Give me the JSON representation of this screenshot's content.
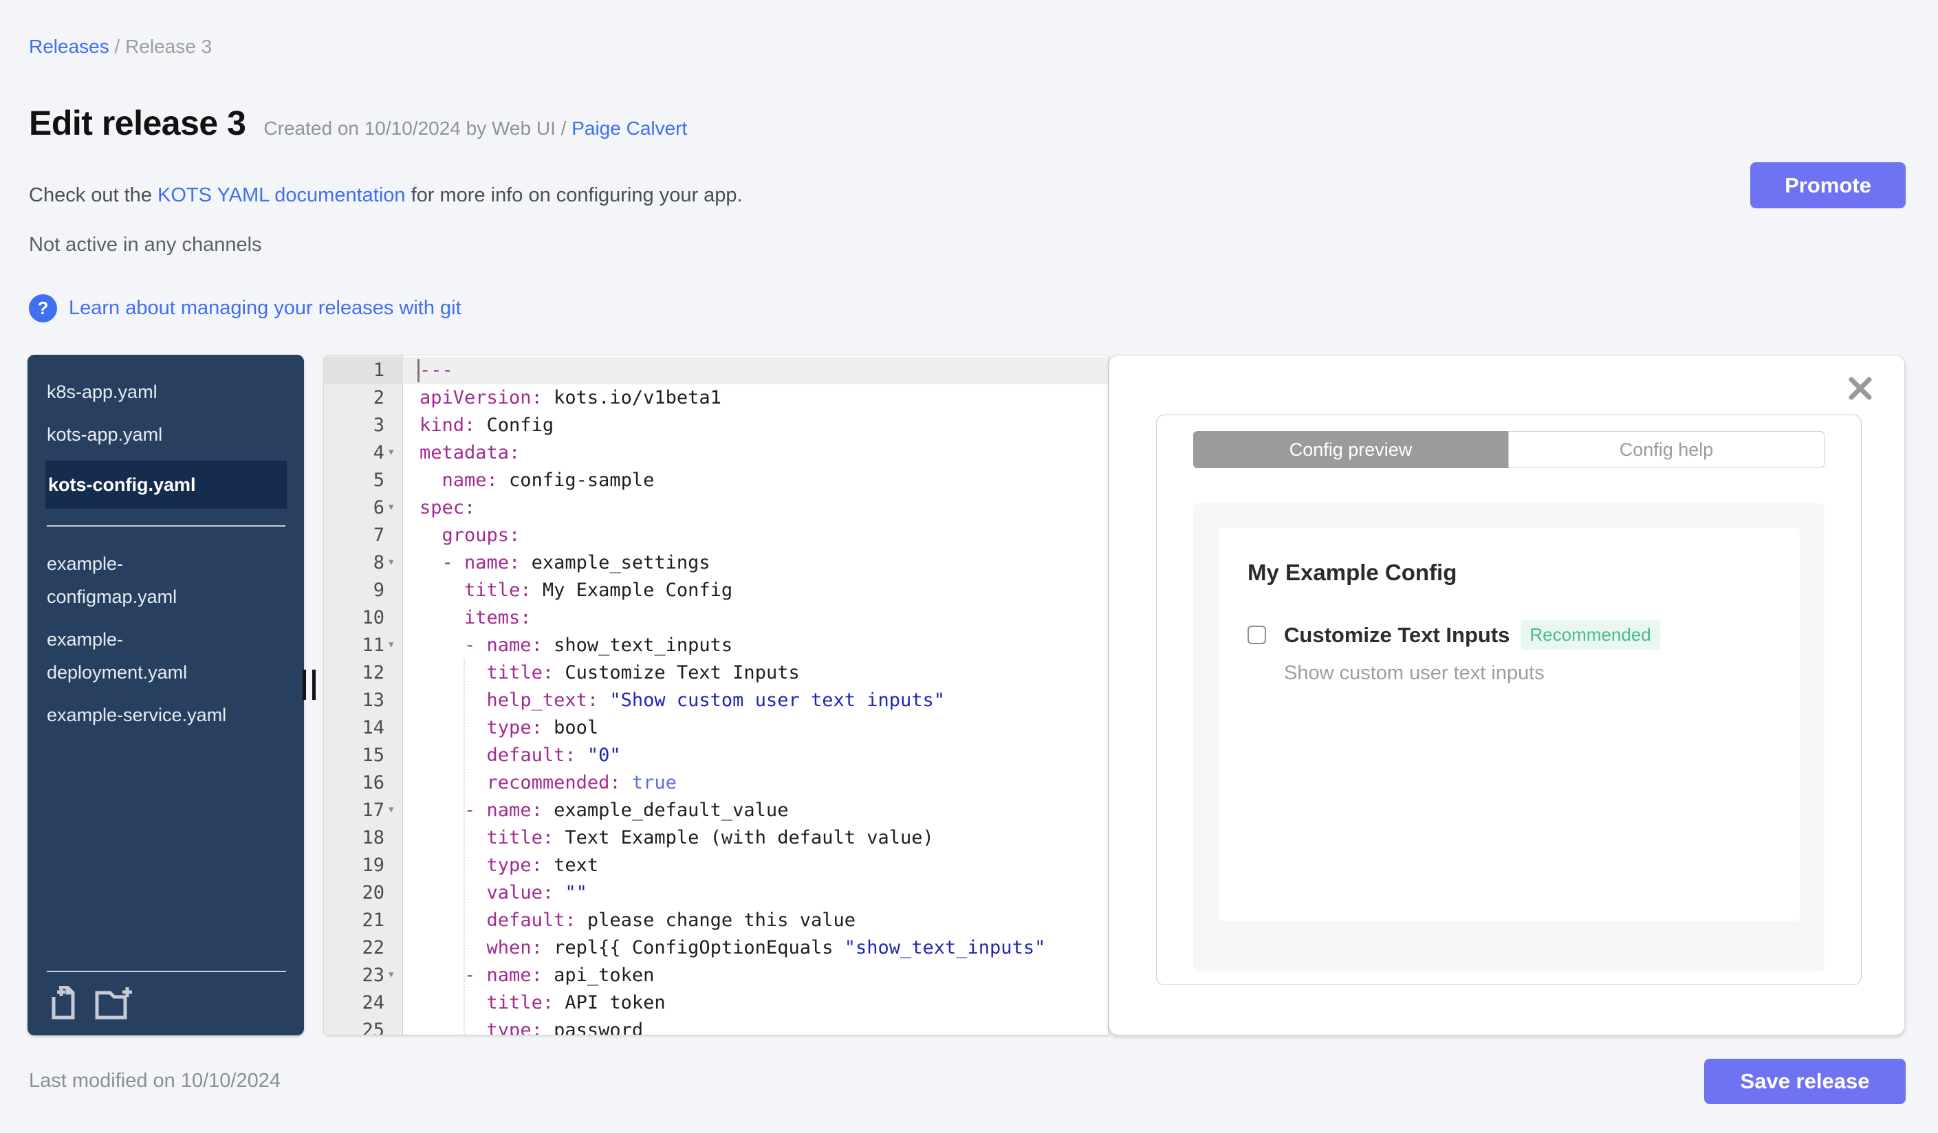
{
  "breadcrumb": {
    "link": "Releases",
    "separator": "/",
    "current": "Release 3"
  },
  "header": {
    "title": "Edit release 3",
    "created_prefix": "Created on 10/10/2024 by Web UI /",
    "created_link": "Paige Calvert",
    "promote_label": "Promote"
  },
  "intro": {
    "pre": "Check out the ",
    "link": "KOTS YAML documentation",
    "post": " for more info on configuring your app.",
    "channel_status": "Not active in any channels"
  },
  "git_link": {
    "icon": "?",
    "label": "Learn about managing your releases with git"
  },
  "sidebar": {
    "files_top": [
      {
        "label": "k8s-app.yaml",
        "selected": false
      },
      {
        "label": "kots-app.yaml",
        "selected": false
      },
      {
        "label": "kots-config.yaml",
        "selected": true
      }
    ],
    "files_bottom": [
      {
        "label": "example-configmap.yaml",
        "selected": false
      },
      {
        "label": "example-deployment.yaml",
        "selected": false
      },
      {
        "label": "example-service.yaml",
        "selected": false
      }
    ],
    "icons": [
      "new-file-icon",
      "new-folder-icon"
    ]
  },
  "editor": {
    "lines": [
      {
        "n": 1,
        "fold": false,
        "active": true,
        "seg": [
          [
            "k",
            "---"
          ]
        ]
      },
      {
        "n": 2,
        "fold": false,
        "active": false,
        "seg": [
          [
            "k",
            "apiVersion:"
          ],
          [
            "v",
            " kots.io/v1beta1"
          ]
        ]
      },
      {
        "n": 3,
        "fold": false,
        "active": false,
        "seg": [
          [
            "k",
            "kind:"
          ],
          [
            "v",
            " Config"
          ]
        ]
      },
      {
        "n": 4,
        "fold": true,
        "active": false,
        "seg": [
          [
            "k",
            "metadata:"
          ]
        ]
      },
      {
        "n": 5,
        "fold": false,
        "active": false,
        "seg": [
          [
            "v",
            "  "
          ],
          [
            "k",
            "name:"
          ],
          [
            "v",
            " config-sample"
          ]
        ]
      },
      {
        "n": 6,
        "fold": true,
        "active": false,
        "seg": [
          [
            "k",
            "spec:"
          ]
        ]
      },
      {
        "n": 7,
        "fold": false,
        "active": false,
        "seg": [
          [
            "v",
            "  "
          ],
          [
            "k",
            "groups:"
          ]
        ]
      },
      {
        "n": 8,
        "fold": true,
        "active": false,
        "seg": [
          [
            "v",
            "  "
          ],
          [
            "k",
            "- name:"
          ],
          [
            "v",
            " example_settings"
          ]
        ]
      },
      {
        "n": 9,
        "fold": false,
        "active": false,
        "seg": [
          [
            "v",
            "    "
          ],
          [
            "k",
            "title:"
          ],
          [
            "v",
            " My Example Config"
          ]
        ]
      },
      {
        "n": 10,
        "fold": false,
        "active": false,
        "seg": [
          [
            "v",
            "    "
          ],
          [
            "k",
            "items:"
          ]
        ]
      },
      {
        "n": 11,
        "fold": true,
        "active": false,
        "seg": [
          [
            "v",
            "    "
          ],
          [
            "k",
            "- name:"
          ],
          [
            "v",
            " show_text_inputs"
          ]
        ]
      },
      {
        "n": 12,
        "fold": false,
        "active": false,
        "seg": [
          [
            "v",
            "      "
          ],
          [
            "k",
            "title:"
          ],
          [
            "v",
            " Customize Text Inputs"
          ]
        ]
      },
      {
        "n": 13,
        "fold": false,
        "active": false,
        "seg": [
          [
            "v",
            "      "
          ],
          [
            "k",
            "help_text:"
          ],
          [
            "v",
            " "
          ],
          [
            "s",
            "\"Show custom user text inputs\""
          ]
        ]
      },
      {
        "n": 14,
        "fold": false,
        "active": false,
        "seg": [
          [
            "v",
            "      "
          ],
          [
            "k",
            "type:"
          ],
          [
            "v",
            " bool"
          ]
        ]
      },
      {
        "n": 15,
        "fold": false,
        "active": false,
        "seg": [
          [
            "v",
            "      "
          ],
          [
            "k",
            "default:"
          ],
          [
            "v",
            " "
          ],
          [
            "s",
            "\"0\""
          ]
        ]
      },
      {
        "n": 16,
        "fold": false,
        "active": false,
        "seg": [
          [
            "v",
            "      "
          ],
          [
            "k",
            "recommended:"
          ],
          [
            "v",
            " "
          ],
          [
            "b",
            "true"
          ]
        ]
      },
      {
        "n": 17,
        "fold": true,
        "active": false,
        "seg": [
          [
            "v",
            "    "
          ],
          [
            "k",
            "- name:"
          ],
          [
            "v",
            " example_default_value"
          ]
        ]
      },
      {
        "n": 18,
        "fold": false,
        "active": false,
        "seg": [
          [
            "v",
            "      "
          ],
          [
            "k",
            "title:"
          ],
          [
            "v",
            " Text Example (with default value)"
          ]
        ]
      },
      {
        "n": 19,
        "fold": false,
        "active": false,
        "seg": [
          [
            "v",
            "      "
          ],
          [
            "k",
            "type:"
          ],
          [
            "v",
            " text"
          ]
        ]
      },
      {
        "n": 20,
        "fold": false,
        "active": false,
        "seg": [
          [
            "v",
            "      "
          ],
          [
            "k",
            "value:"
          ],
          [
            "v",
            " "
          ],
          [
            "s",
            "\"\""
          ]
        ]
      },
      {
        "n": 21,
        "fold": false,
        "active": false,
        "seg": [
          [
            "v",
            "      "
          ],
          [
            "k",
            "default:"
          ],
          [
            "v",
            " please change this value"
          ]
        ]
      },
      {
        "n": 22,
        "fold": false,
        "active": false,
        "seg": [
          [
            "v",
            "      "
          ],
          [
            "k",
            "when:"
          ],
          [
            "v",
            " repl{{ ConfigOptionEquals "
          ],
          [
            "s",
            "\"show_text_inputs\""
          ]
        ]
      },
      {
        "n": 23,
        "fold": true,
        "active": false,
        "seg": [
          [
            "v",
            "    "
          ],
          [
            "k",
            "- name:"
          ],
          [
            "v",
            " api_token"
          ]
        ]
      },
      {
        "n": 24,
        "fold": false,
        "active": false,
        "seg": [
          [
            "v",
            "      "
          ],
          [
            "k",
            "title:"
          ],
          [
            "v",
            " API token"
          ]
        ]
      },
      {
        "n": 25,
        "fold": false,
        "active": false,
        "seg": [
          [
            "v",
            "      "
          ],
          [
            "k",
            "type:"
          ],
          [
            "v",
            " password"
          ]
        ]
      }
    ]
  },
  "config_panel": {
    "close_icon": "close-x",
    "tabs": [
      {
        "label": "Config preview",
        "active": true
      },
      {
        "label": "Config help",
        "active": false
      }
    ],
    "preview": {
      "group_title": "My Example Config",
      "item_label": "Customize Text Inputs",
      "item_badge": "Recommended",
      "item_help": "Show custom user text inputs",
      "item_checked": false
    }
  },
  "footer": {
    "last_modified": "Last modified on 10/10/2024",
    "save_label": "Save release"
  },
  "colors": {
    "accent_button": "#6e73f2",
    "link_blue": "#3f6ff2",
    "sidebar_bg": "#27405f",
    "sidebar_selected_bg": "#142d4f",
    "badge_green": "#4cbb8a",
    "badge_bg": "#e9f7f0",
    "yaml_key": "#a32b8f",
    "yaml_string": "#2026b3",
    "yaml_bool": "#5b6df0",
    "tab_active_bg": "#9b9b9b"
  }
}
